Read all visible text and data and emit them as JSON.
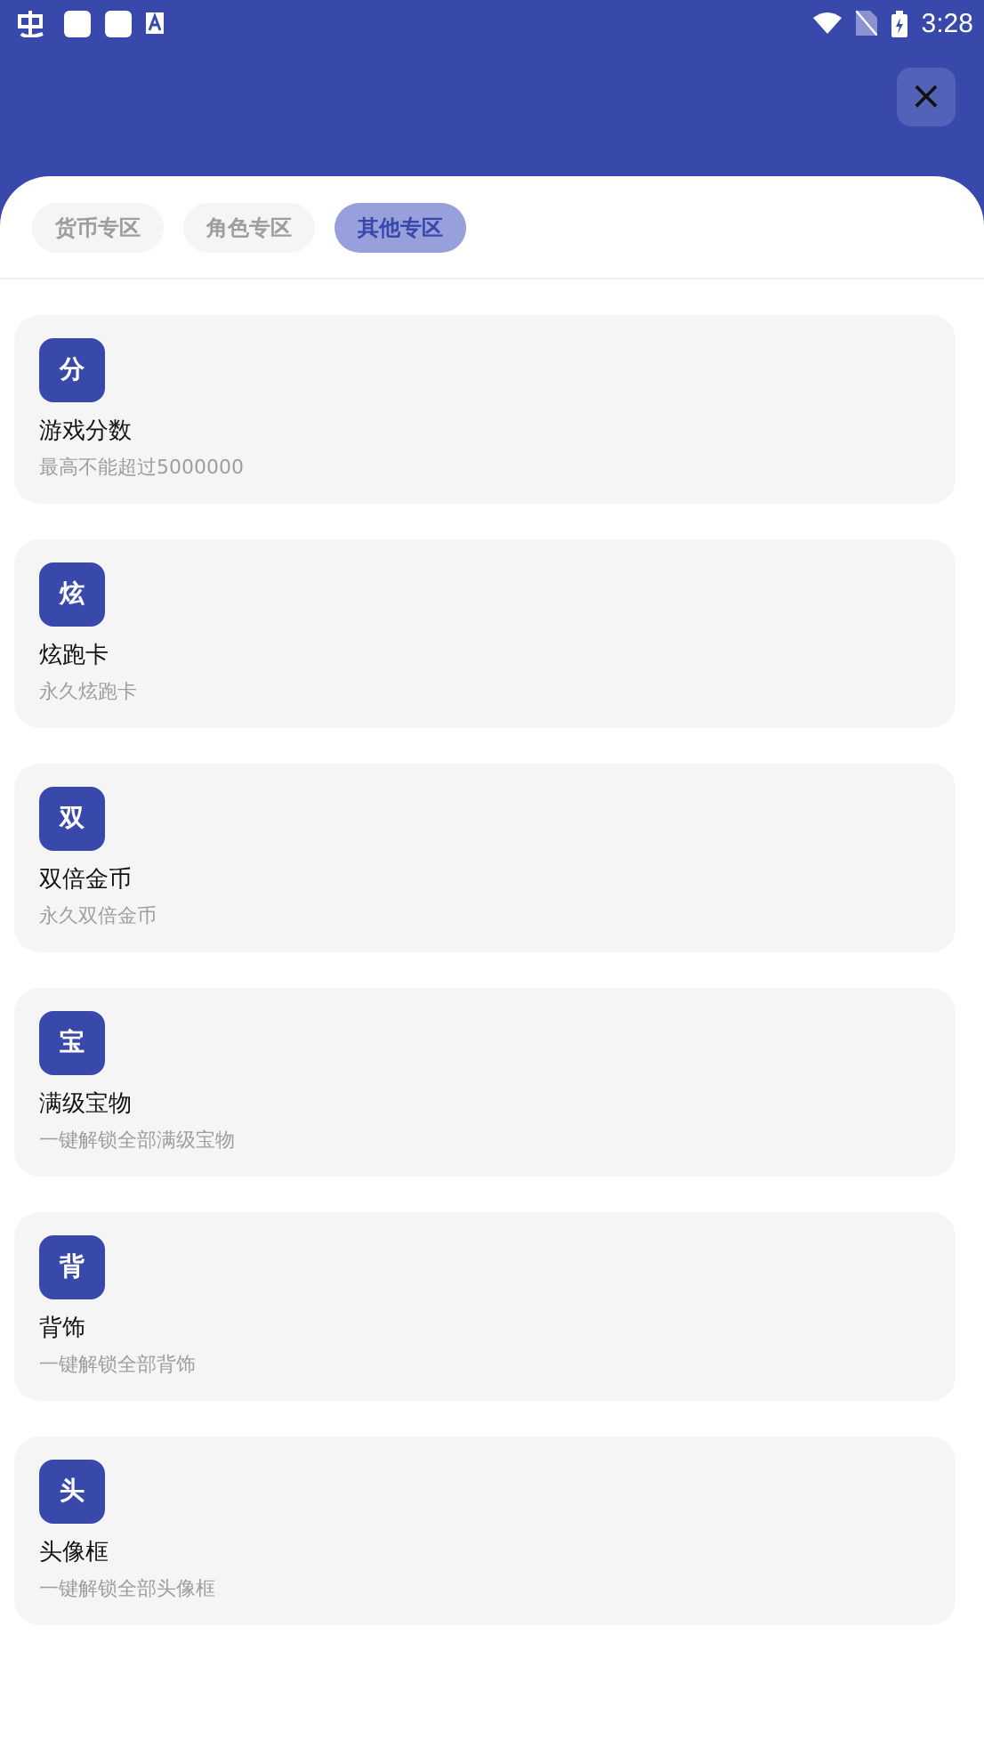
{
  "status_bar": {
    "time": "3:28"
  },
  "close_button": {
    "label": "×"
  },
  "tabs": [
    {
      "label": "货币专区",
      "selected": false
    },
    {
      "label": "角色专区",
      "selected": false
    },
    {
      "label": "其他专区",
      "selected": true
    }
  ],
  "items": [
    {
      "badge": "分",
      "title": "游戏分数",
      "subtitle": "最高不能超过5000000"
    },
    {
      "badge": "炫",
      "title": "炫跑卡",
      "subtitle": "永久炫跑卡"
    },
    {
      "badge": "双",
      "title": "双倍金币",
      "subtitle": "永久双倍金币"
    },
    {
      "badge": "宝",
      "title": "满级宝物",
      "subtitle": "一键解锁全部满级宝物"
    },
    {
      "badge": "背",
      "title": "背饰",
      "subtitle": "一键解锁全部背饰"
    },
    {
      "badge": "头",
      "title": "头像框",
      "subtitle": "一键解锁全部头像框"
    }
  ]
}
